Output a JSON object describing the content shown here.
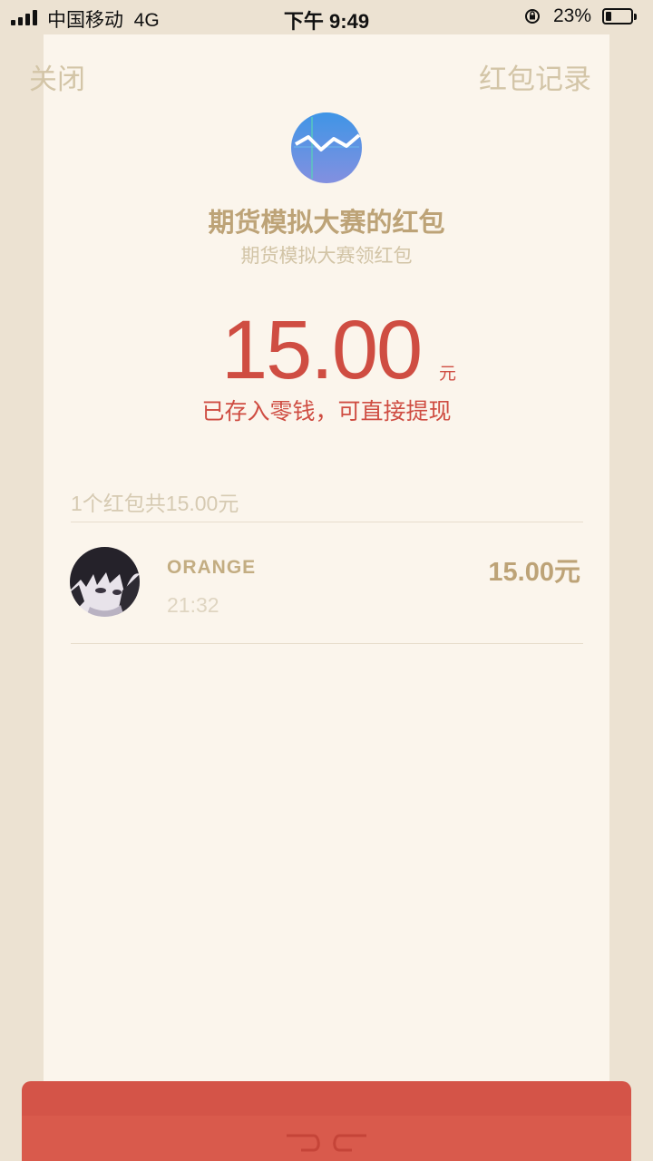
{
  "status_bar": {
    "carrier": "中国移动",
    "network": "4G",
    "time": "下午 9:49",
    "battery_percent": "23%",
    "battery_level": 0.23
  },
  "nav": {
    "close_label": "关闭",
    "records_label": "红包记录"
  },
  "packet": {
    "title": "期货模拟大赛的红包",
    "subtitle": "期货模拟大赛领红包",
    "amount": "15.00",
    "unit": "元",
    "note": "已存入零钱，可直接提现"
  },
  "summary": "1个红包共15.00元",
  "records": [
    {
      "name": "ORANGE",
      "time": "21:32",
      "amount": "15.00元"
    }
  ],
  "colors": {
    "background": "#ece2d2",
    "sheet": "#fbf5ec",
    "gold": "#bda377",
    "red": "#cf4d42"
  }
}
